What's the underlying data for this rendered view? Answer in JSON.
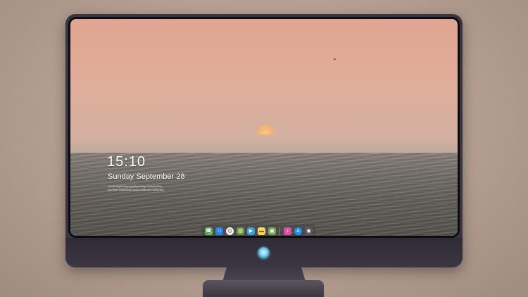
{
  "lockscreen": {
    "time": "15:10",
    "date": "Sunday September 28",
    "note_line1": "Unmerring Metaprompt Bramsmg, instantly RNa,",
    "note_line2": "your time ornamental views of this fuel conduction."
  },
  "dock": {
    "apps": [
      {
        "name": "messages",
        "icon": "💬",
        "color": "#5cc35a"
      },
      {
        "name": "finder",
        "icon": "☺",
        "color": "#2d82e0"
      },
      {
        "name": "clock",
        "icon": "◷",
        "color": "#f2f2f2"
      },
      {
        "name": "preview",
        "icon": "▤",
        "color": "#6b9b3a"
      },
      {
        "name": "claquette",
        "icon": "▶",
        "color": "#3aa0d8"
      },
      {
        "name": "notes",
        "icon": "▬",
        "color": "#f7d65c"
      },
      {
        "name": "photos",
        "icon": "▣",
        "color": "#7aa35a"
      },
      {
        "name": "itunes",
        "icon": "♪",
        "color": "#e04fa7"
      },
      {
        "name": "app-store",
        "icon": "A",
        "color": "#1f8ff0"
      },
      {
        "name": "camera",
        "icon": "◉",
        "color": "#5a5a60"
      }
    ]
  },
  "colors": {
    "monitor_body": "#3a3540",
    "sky_top": "#dfa592",
    "sea": "#6f6b65"
  }
}
